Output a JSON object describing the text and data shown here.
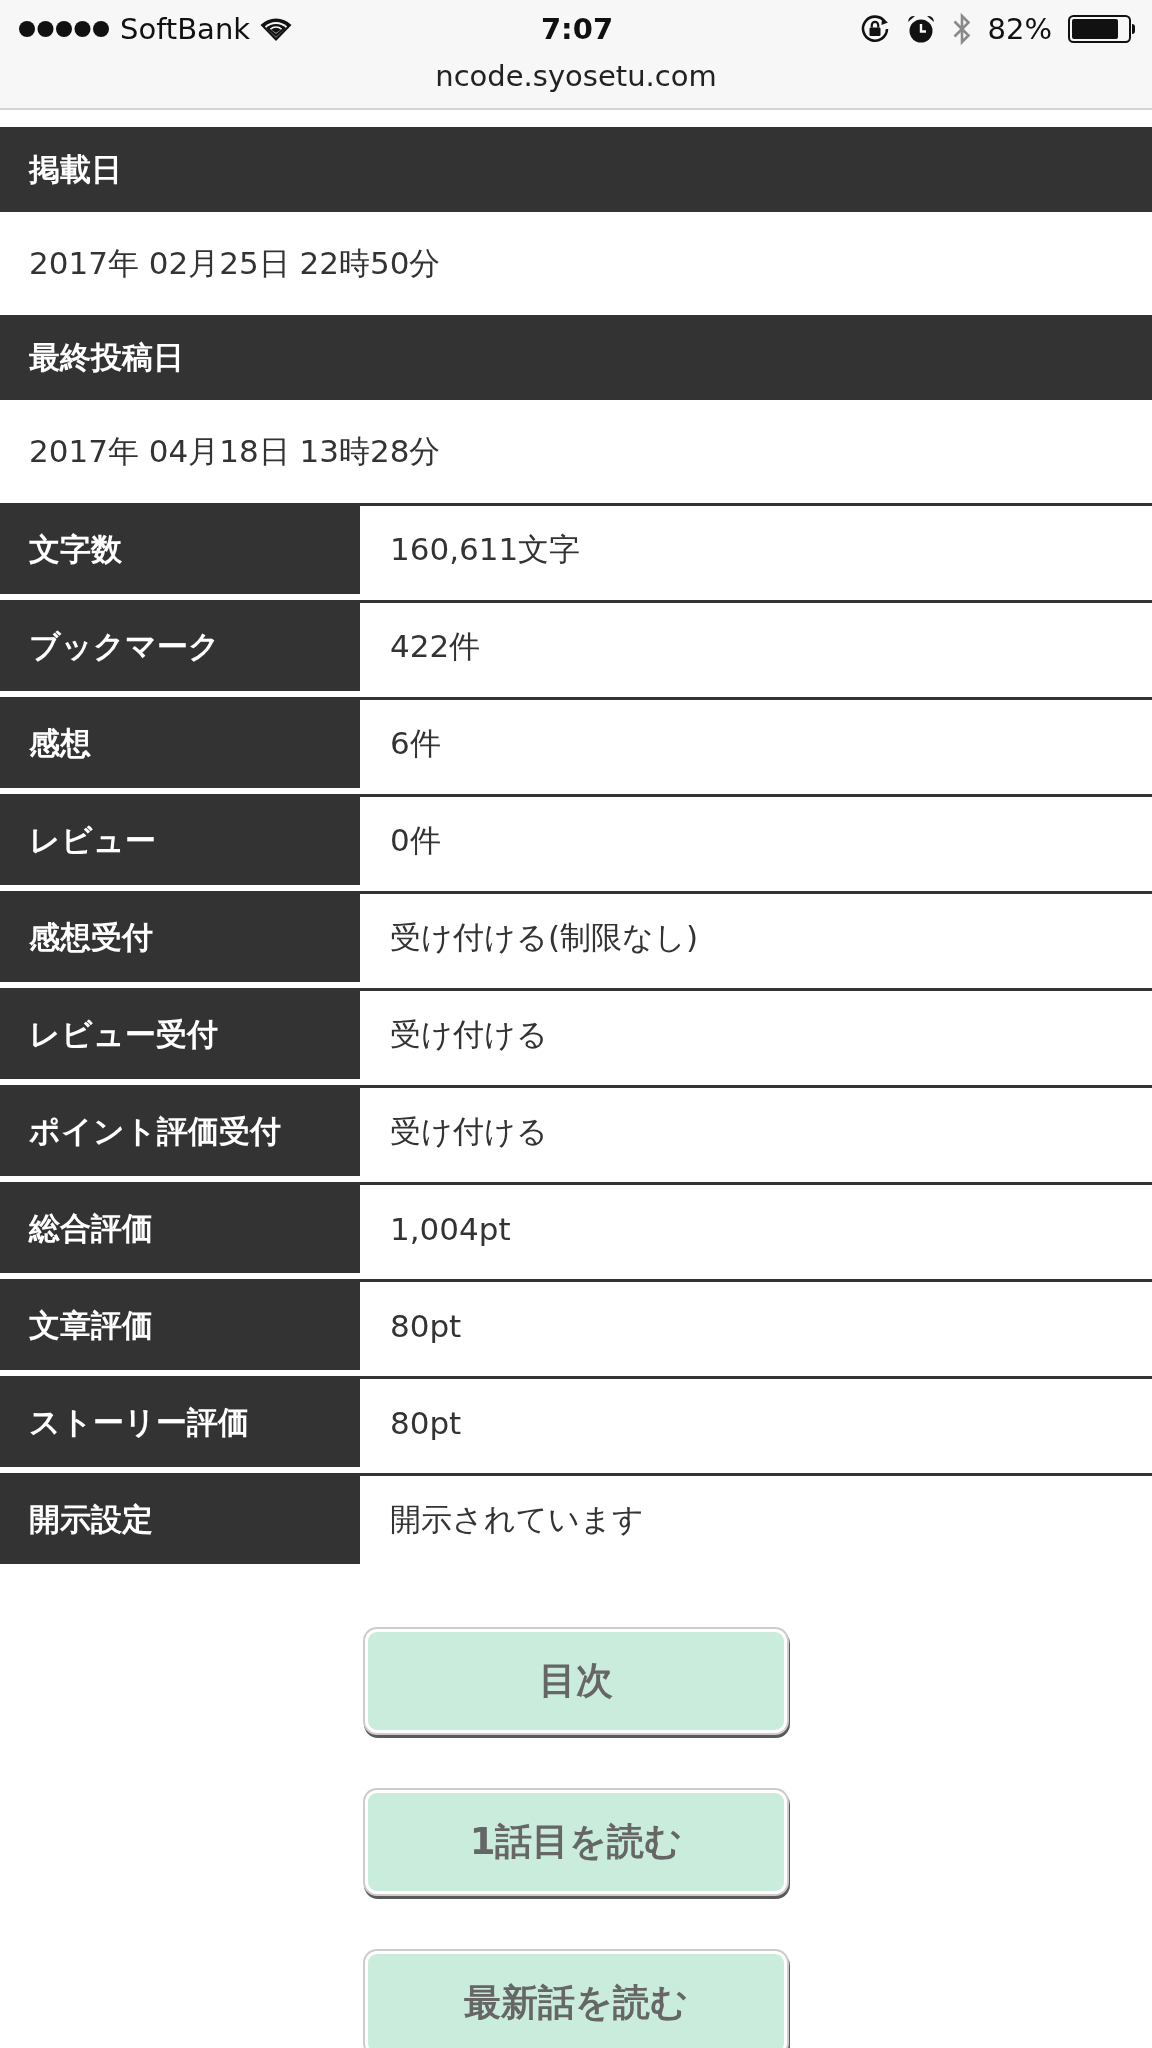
{
  "status_bar": {
    "carrier": "SoftBank",
    "time": "7:07",
    "battery_percent": "82%"
  },
  "address_bar": {
    "url": "ncode.syosetu.com"
  },
  "date_sections": [
    {
      "heading": "掲載日",
      "value": "2017年 02月25日 22時50分"
    },
    {
      "heading": "最終投稿日",
      "value": "2017年 04月18日 13時28分"
    }
  ],
  "info_table": {
    "rows": [
      {
        "label": "文字数",
        "value": "160,611文字"
      },
      {
        "label": "ブックマーク",
        "value": "422件"
      },
      {
        "label": "感想",
        "value": "6件"
      },
      {
        "label": "レビュー",
        "value": "0件"
      },
      {
        "label": "感想受付",
        "value": "受け付ける(制限なし)"
      },
      {
        "label": "レビュー受付",
        "value": "受け付ける"
      },
      {
        "label": "ポイント評価受付",
        "value": "受け付ける"
      },
      {
        "label": "総合評価",
        "value": "1,004pt"
      },
      {
        "label": "文章評価",
        "value": "80pt"
      },
      {
        "label": "ストーリー評価",
        "value": "80pt"
      },
      {
        "label": "開示設定",
        "value": "開示されています"
      }
    ]
  },
  "buttons": [
    {
      "label": "目次"
    },
    {
      "label": "1話目を読む"
    },
    {
      "label": "最新話を読む"
    }
  ]
}
